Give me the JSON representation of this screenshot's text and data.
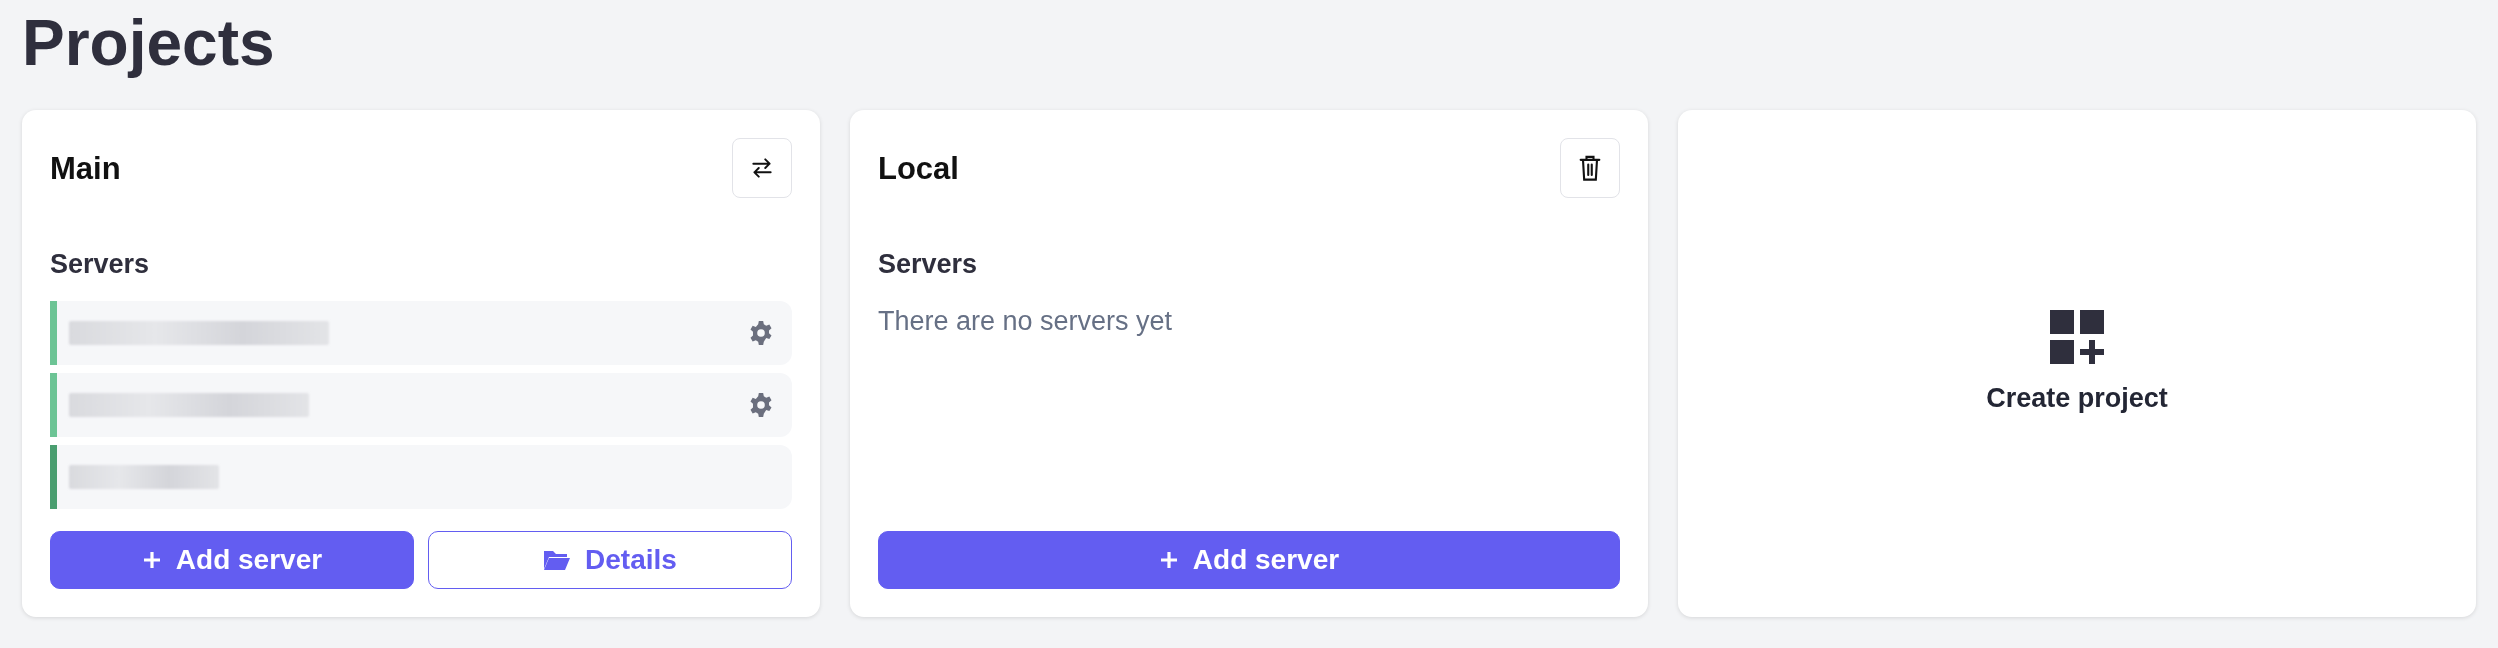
{
  "page_title": "Projects",
  "projects": [
    {
      "name": "Main",
      "header_button": {
        "kind": "switch"
      },
      "servers_heading": "Servers",
      "servers": [
        {
          "color": "#6cc495",
          "has_settings": true
        },
        {
          "color": "#6cc495",
          "has_settings": true
        },
        {
          "color": "#4a9e70",
          "has_settings": false
        }
      ],
      "buttons": [
        {
          "label": "Add server",
          "kind": "add"
        },
        {
          "label": "Details",
          "kind": "details"
        }
      ]
    },
    {
      "name": "Local",
      "header_button": {
        "kind": "delete"
      },
      "servers_heading": "Servers",
      "empty_text": "There are no servers yet",
      "buttons": [
        {
          "label": "Add server",
          "kind": "add"
        }
      ]
    }
  ],
  "create_card": {
    "label": "Create project"
  }
}
